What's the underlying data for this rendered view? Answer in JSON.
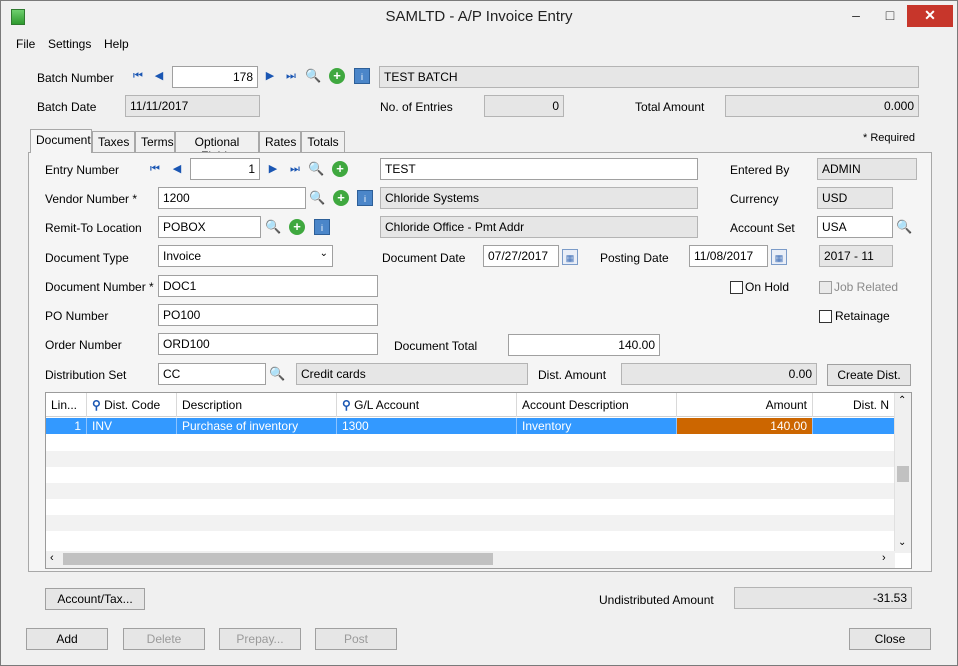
{
  "window": {
    "title": "SAMLTD - A/P Invoice Entry",
    "minimize": "–",
    "maximize": "□",
    "close": "✕"
  },
  "menu": {
    "file": "File",
    "settings": "Settings",
    "help": "Help"
  },
  "header": {
    "batch_number_label": "Batch Number",
    "batch_number": "178",
    "batch_desc": "TEST BATCH",
    "batch_date_label": "Batch Date",
    "batch_date": "11/11/2017",
    "entries_label": "No. of Entries",
    "entries": "0",
    "total_label": "Total Amount",
    "total": "0.000"
  },
  "tabs": [
    "Document",
    "Taxes",
    "Terms",
    "Optional Fields",
    "Rates",
    "Totals"
  ],
  "required_note": "* Required",
  "doc": {
    "entry_label": "Entry Number",
    "entry": "1",
    "entry_desc": "TEST",
    "entered_by_label": "Entered By",
    "entered_by": "ADMIN",
    "vendor_label": "Vendor Number *",
    "vendor": "1200",
    "vendor_name": "Chloride Systems",
    "currency_label": "Currency",
    "currency": "USD",
    "remit_label": "Remit-To Location",
    "remit": "POBOX",
    "remit_name": "Chloride Office - Pmt Addr",
    "account_set_label": "Account Set",
    "account_set": "USA",
    "doctype_label": "Document Type",
    "doctype": "Invoice",
    "docdate_label": "Document Date",
    "docdate": "07/27/2017",
    "postdate_label": "Posting Date",
    "postdate": "11/08/2017",
    "period": "2017 - 11",
    "docnum_label": "Document Number *",
    "docnum": "DOC1",
    "onhold_label": "On Hold",
    "job_label": "Job Related",
    "po_label": "PO Number",
    "po": "PO100",
    "retainage_label": "Retainage",
    "order_label": "Order Number",
    "order": "ORD100",
    "doctotal_label": "Document Total",
    "doctotal": "140.00",
    "distset_label": "Distribution Set",
    "distset": "CC",
    "distset_name": "Credit cards",
    "distamt_label": "Dist. Amount",
    "distamt": "0.00",
    "create_dist": "Create Dist."
  },
  "grid": {
    "headers": [
      "Lin...",
      "Dist. Code",
      "Description",
      "G/L Account",
      "Account Description",
      "Amount",
      "Dist. N"
    ],
    "rows": [
      [
        "1",
        "INV",
        "Purchase of inventory",
        "1300",
        "Inventory",
        "140.00",
        ""
      ]
    ]
  },
  "bottom": {
    "account_tax": "Account/Tax...",
    "undistributed_label": "Undistributed Amount",
    "undistributed": "-31.53",
    "add": "Add",
    "delete": "Delete",
    "prepay": "Prepay...",
    "post": "Post",
    "close": "Close"
  },
  "icons": {
    "first": "⏮",
    "prev": "◀",
    "next": "▶",
    "last": "⏭",
    "search": "🔍",
    "new": "+",
    "info": "i",
    "calendar": "▦"
  }
}
